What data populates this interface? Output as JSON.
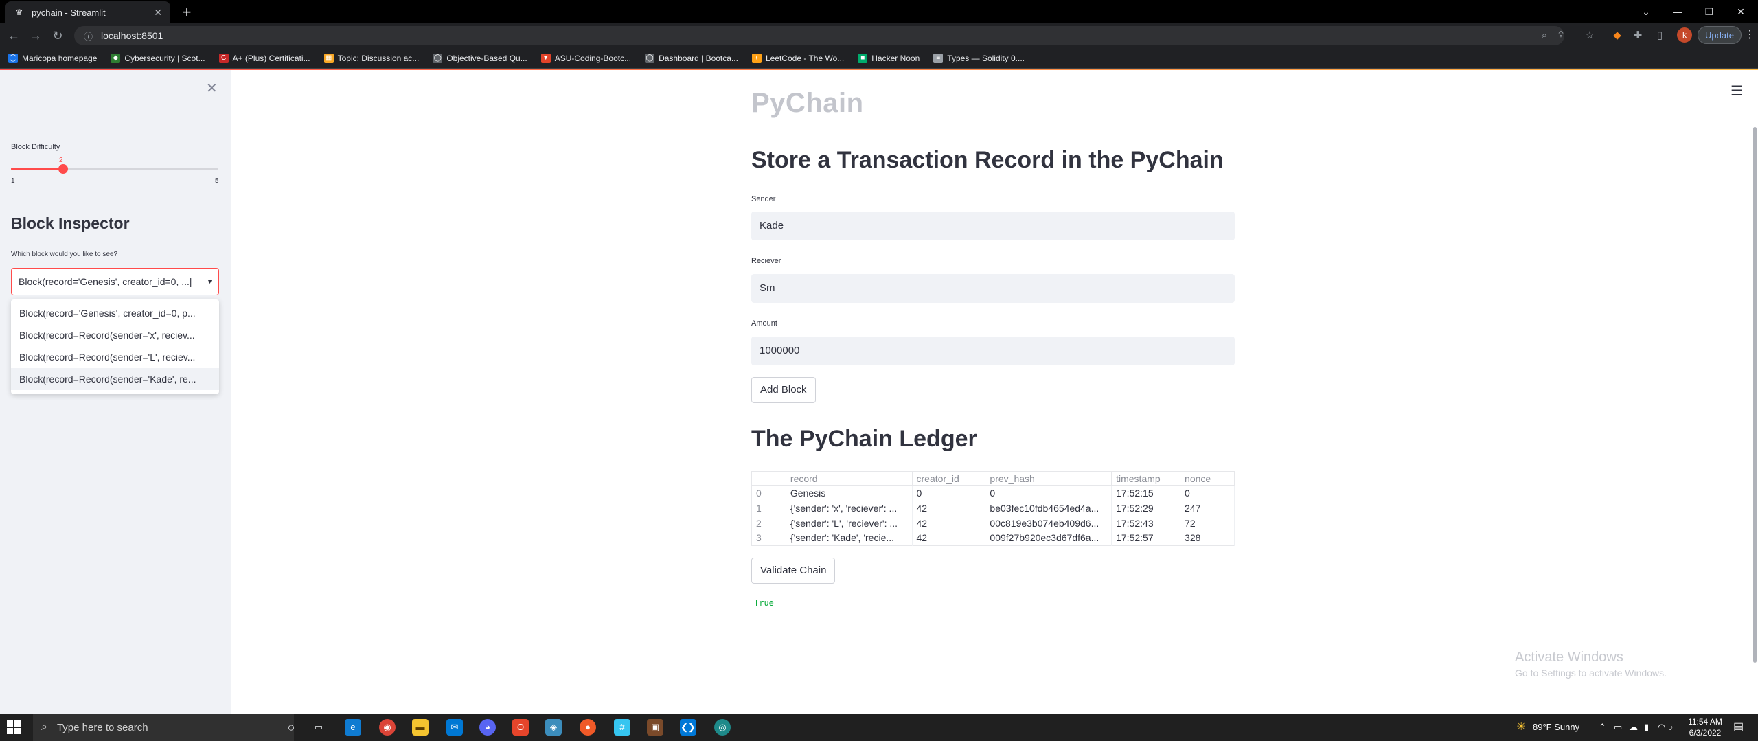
{
  "browser": {
    "tab_title": "pychain - Streamlit",
    "url": "localhost:8501",
    "update_label": "Update",
    "profile_initial": "k",
    "bookmarks": [
      "Maricopa homepage",
      "Cybersecurity | Scot...",
      "A+ (Plus) Certificati...",
      "Topic: Discussion ac...",
      "Objective-Based Qu...",
      "ASU-Coding-Bootc...",
      "Dashboard | Bootca...",
      "LeetCode - The Wo...",
      "Hacker Noon",
      "Types — Solidity 0...."
    ]
  },
  "sidebar": {
    "slider": {
      "label": "Block Difficulty",
      "value": 2,
      "min": 1,
      "max": 5,
      "min_label": "1",
      "max_label": "5",
      "value_label": "2"
    },
    "inspector_title": "Block Inspector",
    "question": "Which block would you like to see?",
    "selected": "Block(record='Genesis', creator_id=0, ...|",
    "options": [
      "Block(record='Genesis', creator_id=0, p...",
      "Block(record=Record(sender='x', reciev...",
      "Block(record=Record(sender='L', reciev...",
      "Block(record=Record(sender='Kade', re..."
    ]
  },
  "main": {
    "title": "PyChain",
    "form_title": "Store a Transaction Record in the PyChain",
    "sender_label": "Sender",
    "sender_value": "Kade",
    "receiver_label": "Reciever",
    "receiver_value": "Sm",
    "amount_label": "Amount",
    "amount_value": "1000000",
    "add_block_label": "Add Block",
    "ledger_title": "The PyChain Ledger",
    "ledger": {
      "columns": [
        "",
        "record",
        "creator_id",
        "prev_hash",
        "timestamp",
        "nonce"
      ],
      "rows": [
        [
          "0",
          "Genesis",
          "0",
          "0",
          "17:52:15",
          "0"
        ],
        [
          "1",
          "{'sender': 'x', 'reciever': ...",
          "42",
          "be03fec10fdb4654ed4a...",
          "17:52:29",
          "247"
        ],
        [
          "2",
          "{'sender': 'L', 'reciever': ...",
          "42",
          "00c819e3b074eb409d6...",
          "17:52:43",
          "72"
        ],
        [
          "3",
          "{'sender': 'Kade', 'recie...",
          "42",
          "009f27b920ec3d67df6a...",
          "17:52:57",
          "328"
        ]
      ]
    },
    "validate_label": "Validate Chain",
    "validate_result": "True"
  },
  "watermark": {
    "line1": "Activate Windows",
    "line2": "Go to Settings to activate Windows."
  },
  "taskbar": {
    "search_placeholder": "Type here to search",
    "weather": "89°F  Sunny",
    "time": "11:54 AM",
    "date": "6/3/2022"
  },
  "colors": {
    "accent": "#ff4b4b",
    "success": "#09ab3b",
    "sidebar_bg": "#f0f2f6"
  }
}
